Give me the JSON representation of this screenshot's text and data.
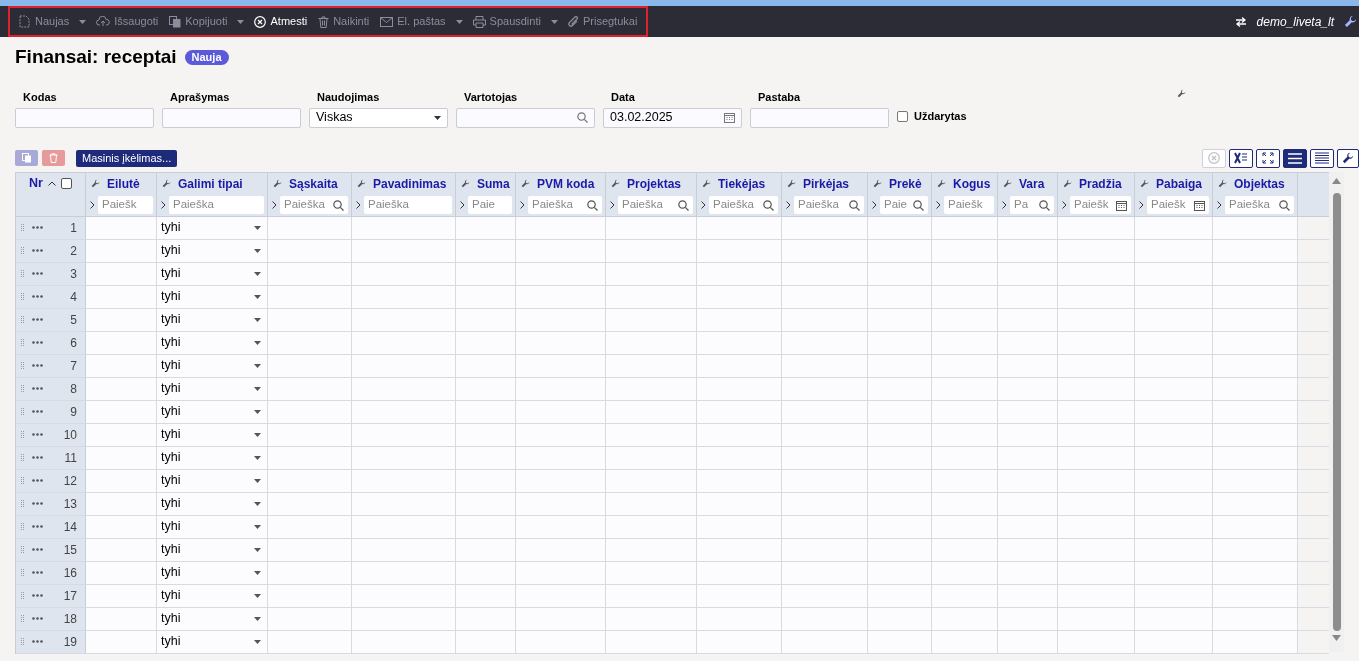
{
  "toolbar": {
    "items": [
      {
        "label": "Naujas",
        "kind": "new",
        "dropdown": true,
        "disabled": true
      },
      {
        "label": "Išsaugoti",
        "kind": "upload",
        "dropdown": false,
        "disabled": true
      },
      {
        "label": "Kopijuoti",
        "kind": "copy",
        "dropdown": true,
        "disabled": true
      },
      {
        "label": "Atmesti",
        "kind": "cancel",
        "dropdown": false,
        "disabled": false
      },
      {
        "label": "Naikinti",
        "kind": "trash",
        "dropdown": false,
        "disabled": true
      },
      {
        "label": "El. paštas",
        "kind": "mail",
        "dropdown": true,
        "disabled": true
      },
      {
        "label": "Spausdinti",
        "kind": "print",
        "dropdown": true,
        "disabled": true
      },
      {
        "label": "Prisegtukai",
        "kind": "clip",
        "dropdown": false,
        "disabled": true
      }
    ],
    "user": "demo_liveta_lt"
  },
  "title": "Finansai: receptai",
  "badge": "Nauja",
  "fields": [
    {
      "label": "Kodas",
      "kind": "text"
    },
    {
      "label": "Aprašymas",
      "kind": "text"
    },
    {
      "label": "Naudojimas",
      "kind": "select",
      "value": "Viskas"
    },
    {
      "label": "Vartotojas",
      "kind": "search"
    },
    {
      "label": "Data",
      "kind": "date",
      "value": "03.02.2025"
    },
    {
      "label": "Pastaba",
      "kind": "text"
    }
  ],
  "closed": {
    "label": "Uždarytas",
    "checked": false
  },
  "bulk_button": "Masinis įkėlimas...",
  "view_buttons": [
    {
      "kind": "cancel",
      "selected": false,
      "disabled": true
    },
    {
      "kind": "excel",
      "selected": false,
      "disabled": false
    },
    {
      "kind": "expand",
      "selected": false,
      "disabled": false
    },
    {
      "kind": "list",
      "selected": true,
      "disabled": false
    },
    {
      "kind": "lines",
      "selected": false,
      "disabled": false
    }
  ],
  "table": {
    "number_header": "Nr",
    "select_all": {
      "checked": false
    },
    "columns": [
      {
        "label": "Eilutė",
        "filter": "Paiešk",
        "kind": "plain"
      },
      {
        "label": "Galimi tipai",
        "filter": "Paieška",
        "kind": "plain"
      },
      {
        "label": "Sąskaita",
        "filter": "Paieška",
        "kind": "search"
      },
      {
        "label": "Pavadinimas",
        "filter": "Paieška",
        "kind": "plain"
      },
      {
        "label": "Suma",
        "filter": "Paie",
        "kind": "plain"
      },
      {
        "label": "PVM koda",
        "filter": "Paieška",
        "kind": "search"
      },
      {
        "label": "Projektas",
        "filter": "Paieška",
        "kind": "search"
      },
      {
        "label": "Tiekėjas",
        "filter": "Paieška",
        "kind": "search"
      },
      {
        "label": "Pirkėjas",
        "filter": "Paieška",
        "kind": "search"
      },
      {
        "label": "Prekė",
        "filter": "Paie",
        "kind": "search"
      },
      {
        "label": "Kogus",
        "filter": "Paiešk",
        "kind": "plain"
      },
      {
        "label": "Vara",
        "filter": "Pa",
        "kind": "search"
      },
      {
        "label": "Pradžia",
        "filter": "Paiešk",
        "kind": "calendar"
      },
      {
        "label": "Pabaiga",
        "filter": "Paiešk",
        "kind": "calendar"
      },
      {
        "label": "Objektas",
        "filter": "Paieška",
        "kind": "search"
      }
    ],
    "rows": [
      {
        "nr": "1",
        "type": "tyhi"
      },
      {
        "nr": "2",
        "type": "tyhi"
      },
      {
        "nr": "3",
        "type": "tyhi"
      },
      {
        "nr": "4",
        "type": "tyhi"
      },
      {
        "nr": "5",
        "type": "tyhi"
      },
      {
        "nr": "6",
        "type": "tyhi"
      },
      {
        "nr": "7",
        "type": "tyhi"
      },
      {
        "nr": "8",
        "type": "tyhi"
      },
      {
        "nr": "9",
        "type": "tyhi"
      },
      {
        "nr": "10",
        "type": "tyhi"
      },
      {
        "nr": "11",
        "type": "tyhi"
      },
      {
        "nr": "12",
        "type": "tyhi"
      },
      {
        "nr": "13",
        "type": "tyhi"
      },
      {
        "nr": "14",
        "type": "tyhi"
      },
      {
        "nr": "15",
        "type": "tyhi"
      },
      {
        "nr": "16",
        "type": "tyhi"
      },
      {
        "nr": "17",
        "type": "tyhi"
      },
      {
        "nr": "18",
        "type": "tyhi"
      },
      {
        "nr": "19",
        "type": "tyhi"
      }
    ]
  }
}
